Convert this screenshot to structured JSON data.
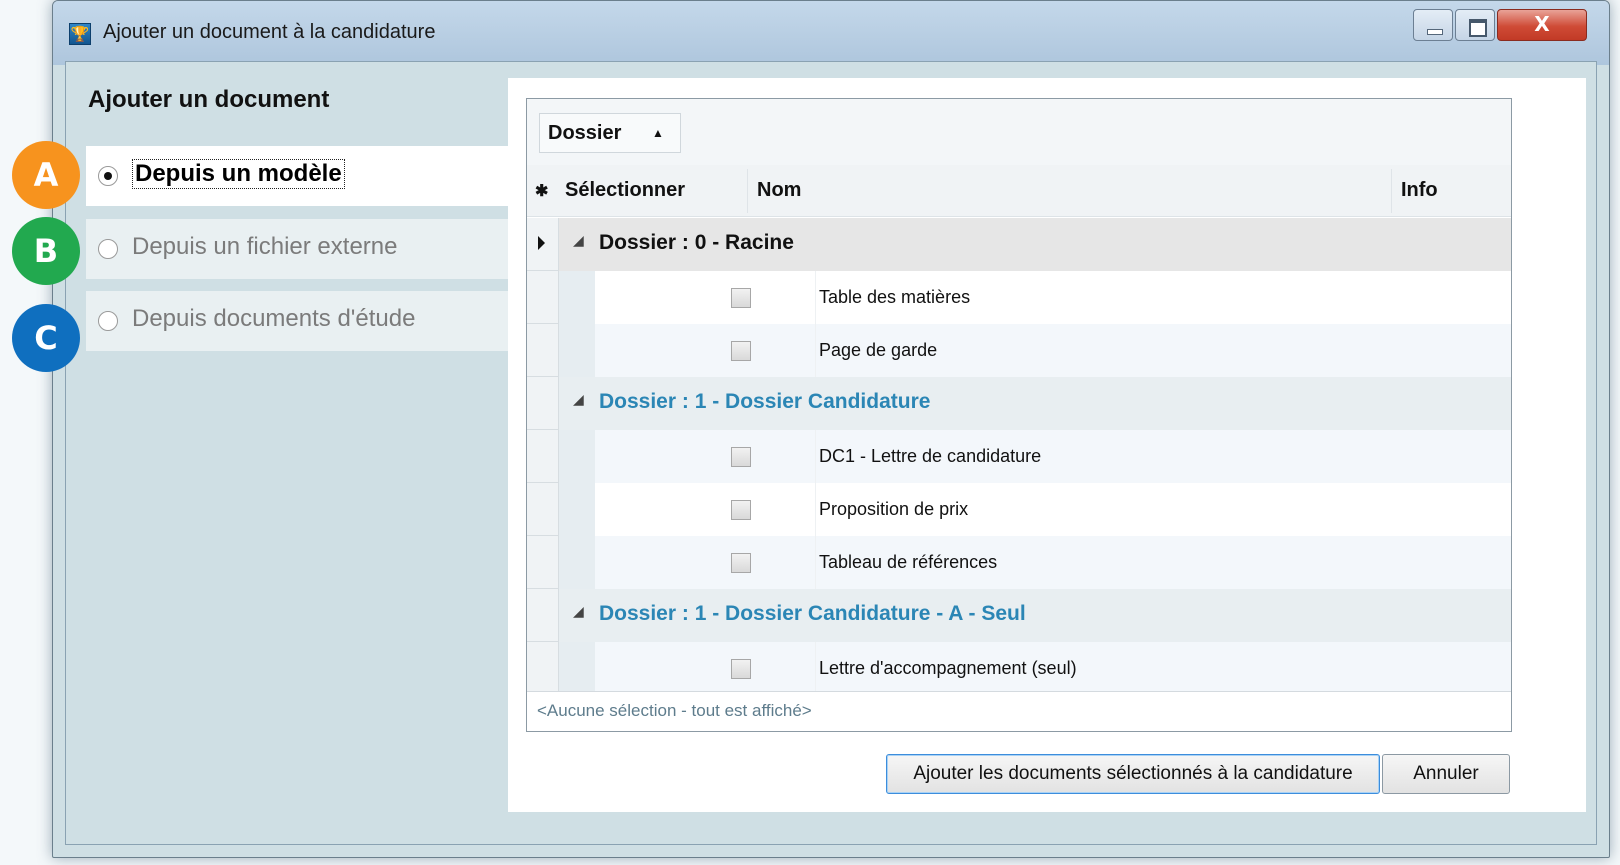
{
  "window": {
    "title": "Ajouter un document à la candidature",
    "title_icon": "trophy-icon",
    "close_glyph": "X"
  },
  "left": {
    "title": "Ajouter un document",
    "options": [
      {
        "badge": "A",
        "badge_color": "#f7931e",
        "label": "Depuis un modèle",
        "selected": true
      },
      {
        "badge": "B",
        "badge_color": "#22a94f",
        "label": "Depuis un fichier externe",
        "selected": false
      },
      {
        "badge": "C",
        "badge_color": "#0f6fbf",
        "label": "Depuis documents d'étude",
        "selected": false
      }
    ]
  },
  "grid": {
    "group_chip": "Dossier",
    "columns": {
      "select": "Sélectionner",
      "name": "Nom",
      "info": "Info"
    },
    "groups": [
      {
        "title": "Dossier : 0 - Racine",
        "items": [
          "Table des matières",
          "Page de garde"
        ]
      },
      {
        "title": "Dossier : 1 - Dossier Candidature",
        "items": [
          "DC1 - Lettre de candidature",
          "Proposition de prix",
          "Tableau de références"
        ]
      },
      {
        "title": "Dossier : 1 - Dossier Candidature - A - Seul",
        "items": [
          "Lettre d'accompagnement (seul)"
        ]
      }
    ],
    "footer": "<Aucune sélection - tout est affiché>"
  },
  "buttons": {
    "add": "Ajouter les documents sélectionnés à la candidature",
    "cancel": "Annuler"
  },
  "colors": {
    "group_title": "#2b86b5",
    "window_bg": "#cfdfe4"
  }
}
